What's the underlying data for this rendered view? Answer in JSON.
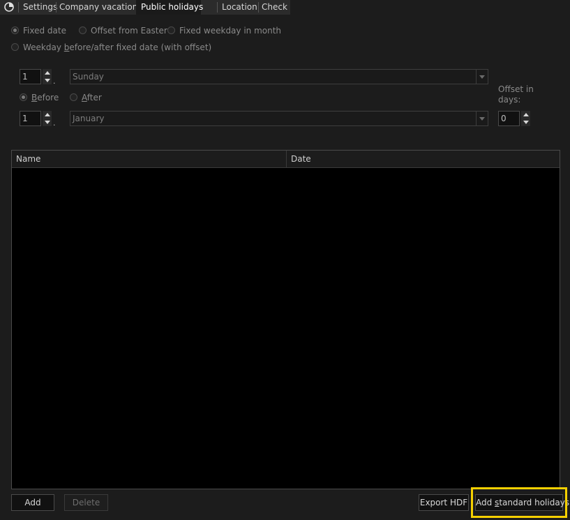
{
  "tabs": [
    {
      "label": "Settings",
      "active": false
    },
    {
      "label": "Company vacations",
      "active": false
    },
    {
      "label": "Public holidays",
      "active": true
    },
    {
      "label": "Location",
      "active": false
    },
    {
      "label": "Check",
      "active": false
    }
  ],
  "rule_type": {
    "fixed_date": "Fixed date",
    "offset_from_easter": "Offset from Easter",
    "fixed_weekday_in_month": "Fixed weekday in month",
    "weekday_before_after_pre": "Weekday ",
    "weekday_before_after_ul": "b",
    "weekday_before_after_post": "efore/after fixed date (with offset)",
    "selected": "Fixed date"
  },
  "weekday_row": {
    "number": "1",
    "weekday": "Sunday"
  },
  "before_after": {
    "before_ul": "B",
    "before_rest": "efore",
    "after_ul": "A",
    "after_rest": "fter",
    "selected": "Before"
  },
  "month_row": {
    "number": "1",
    "month": "January"
  },
  "offset": {
    "label_line1": "Offset in",
    "label_line2": "days:",
    "value": "0"
  },
  "table": {
    "columns": [
      "Name",
      "Date"
    ],
    "rows": []
  },
  "buttons": {
    "add": "Add",
    "delete": "Delete",
    "export": "Export HDF",
    "add_standard_pre": "Add ",
    "add_standard_ul": "s",
    "add_standard_post": "tandard holidays"
  },
  "colors": {
    "highlight": "#f5d000",
    "background": "#1c1c1c",
    "table_bg": "#000000"
  }
}
